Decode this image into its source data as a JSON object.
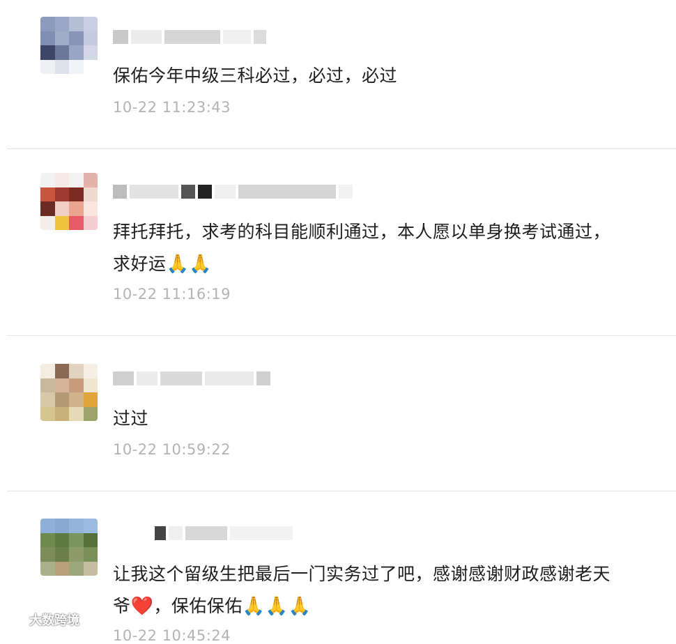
{
  "comments": [
    {
      "text": "保佑今年中级三科必过，必过，必过",
      "time": "10-22 11:23:43",
      "emoji": ""
    },
    {
      "text": "拜托拜托，求考的科目能顺利通过，本人愿以单身换考试通过，求好运",
      "time": "10-22 11:16:19",
      "emoji": "🙏🙏"
    },
    {
      "text": "过过",
      "time": "10-22 10:59:22",
      "emoji": ""
    },
    {
      "text": "让我这个留级生把最后一门实务过了吧，感谢感谢财政感谢老天爷",
      "text_tail": "，保佑保佑",
      "heart": "❤️",
      "time": "10-22 10:45:24",
      "emoji": "🙏🙏🙏"
    }
  ],
  "watermark": {
    "label": "大数跨境"
  }
}
